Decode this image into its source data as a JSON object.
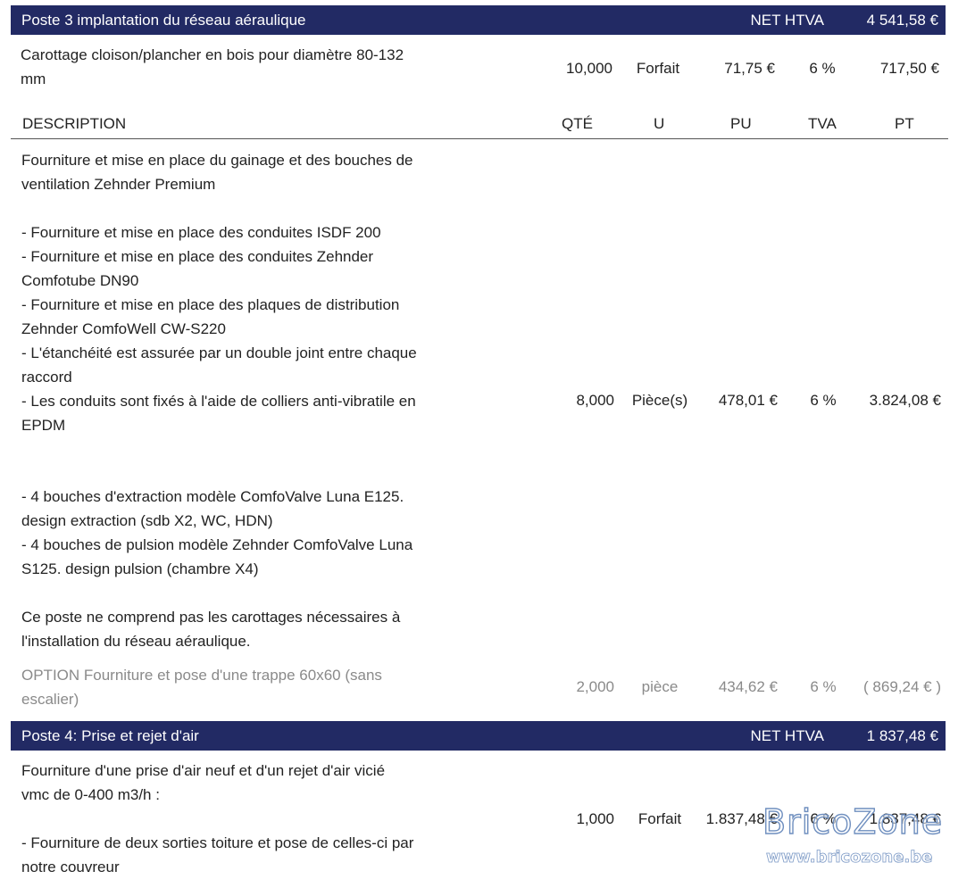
{
  "poste3": {
    "title": "Poste 3 implantation du réseau aéraulique",
    "net_label": "NET HTVA",
    "total": "4 541,58 €"
  },
  "row1": {
    "description": "Carottage cloison/plancher en bois pour diamètre 80-132\nmm",
    "qty": "10,000",
    "unit": "Forfait",
    "pu": "71,75 €",
    "tva": "6 %",
    "pt": "717,50 €"
  },
  "table_header": {
    "description": "DESCRIPTION",
    "qty": "QTÉ",
    "unit": "U",
    "pu": "PU",
    "tva": "TVA",
    "pt": "PT"
  },
  "row2": {
    "description_a": "Fourniture et mise en place du gainage et des bouches de\nventilation Zehnder Premium\n\n- Fourniture et mise en place des conduites ISDF 200\n- Fourniture et mise en place des conduites Zehnder\nComfotube DN90\n- Fourniture et mise en place des plaques de distribution\nZehnder ComfoWell CW-S220\n- L'étanchéité est assurée par un double joint entre chaque\nraccord\n- Les conduits sont fixés à l'aide de colliers anti-vibratile en\nEPDM",
    "description_b": "-  4 bouches d'extraction modèle ComfoValve Luna E125.\ndesign extraction (sdb X2, WC, HDN)\n-  4 bouches de pulsion modèle Zehnder ComfoValve Luna\nS125. design pulsion (chambre X4)\n\nCe poste ne comprend pas les carottages nécessaires à\nl'installation du réseau aéraulique.",
    "qty": "8,000",
    "unit": "Pièce(s)",
    "pu": "478,01 €",
    "tva": "6 %",
    "pt": "3.824,08 €"
  },
  "option_row": {
    "description": "OPTION Fourniture et pose d'une trappe 60x60 (sans\nescalier)",
    "qty": "2,000",
    "unit": "pièce",
    "pu": "434,62 €",
    "tva": "6 %",
    "pt": "( 869,24 € )"
  },
  "poste4": {
    "title": "Poste 4: Prise et rejet d'air",
    "net_label": "NET HTVA",
    "total": "1 837,48 €"
  },
  "row3": {
    "description": "Fourniture d'une prise d'air neuf et d'un rejet d'air vicié\nvmc de 0-400 m3/h :\n\n- Fourniture de deux sorties toiture et pose de celles-ci par\nnotre couvreur",
    "qty": "1,000",
    "unit": "Forfait",
    "pu": "1.837,48 €",
    "tva": "6 %",
    "pt": "1.837,48 €"
  },
  "watermark": {
    "brand": "BricoZone",
    "url": "www.bricozone.be"
  }
}
